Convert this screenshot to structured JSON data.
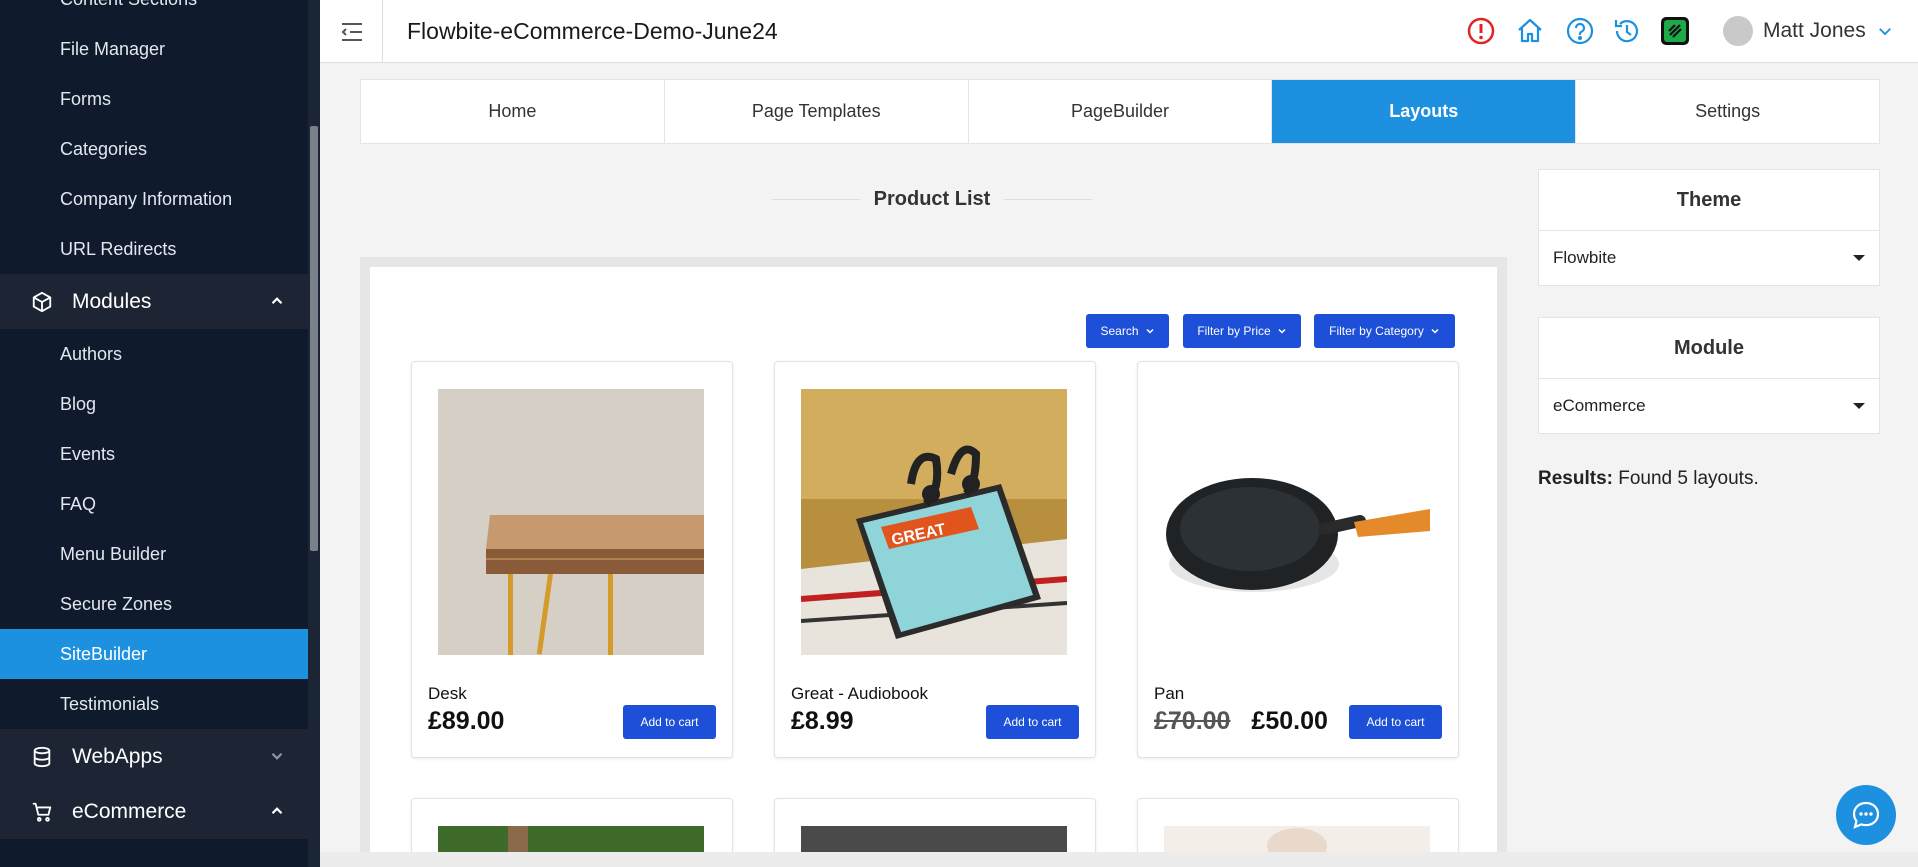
{
  "sidebar": {
    "items_top": [
      {
        "label": "Content Sections"
      },
      {
        "label": "File Manager"
      },
      {
        "label": "Forms"
      },
      {
        "label": "Categories"
      },
      {
        "label": "Company Information"
      },
      {
        "label": "URL Redirects"
      }
    ],
    "groups": {
      "modules": {
        "label": "Modules",
        "icon": "cube-icon"
      },
      "webapps": {
        "label": "WebApps",
        "icon": "database-icon"
      },
      "ecommerce": {
        "label": "eCommerce",
        "icon": "cart-icon"
      }
    },
    "module_items": [
      {
        "label": "Authors"
      },
      {
        "label": "Blog"
      },
      {
        "label": "Events"
      },
      {
        "label": "FAQ"
      },
      {
        "label": "Menu Builder"
      },
      {
        "label": "Secure Zones"
      },
      {
        "label": "SiteBuilder",
        "active": true
      },
      {
        "label": "Testimonials"
      }
    ]
  },
  "topbar": {
    "title": "Flowbite-eCommerce-Demo-June24",
    "user_name": "Matt Jones",
    "icons": [
      "alert-icon",
      "home-icon",
      "help-icon",
      "history-icon",
      "app-logo-icon"
    ],
    "colors": {
      "alert": "#e02424",
      "icons": "#1e90e0",
      "logo_bg": "#1faa4a"
    }
  },
  "tabs": [
    {
      "label": "Home"
    },
    {
      "label": "Page Templates"
    },
    {
      "label": "PageBuilder"
    },
    {
      "label": "Layouts",
      "active": true
    },
    {
      "label": "Settings"
    }
  ],
  "main": {
    "section_title": "Product List",
    "filters": [
      {
        "label": "Search"
      },
      {
        "label": "Filter by Price"
      },
      {
        "label": "Filter by Category"
      }
    ],
    "products": [
      {
        "name": "Desk",
        "price": "£89.00",
        "old_price": "",
        "cart_label": "Add to cart"
      },
      {
        "name": "Great - Audiobook",
        "price": "£8.99",
        "old_price": "",
        "cart_label": "Add to cart"
      },
      {
        "name": "Pan",
        "price": "£50.00",
        "old_price": "£70.00",
        "cart_label": "Add to cart"
      }
    ]
  },
  "right_panel": {
    "theme": {
      "heading": "Theme",
      "value": "Flowbite"
    },
    "module": {
      "heading": "Module",
      "value": "eCommerce"
    },
    "results_label": "Results:",
    "results_text": "Found 5 layouts."
  },
  "accent": "#1e90e0",
  "button_blue": "#1d4fd8"
}
